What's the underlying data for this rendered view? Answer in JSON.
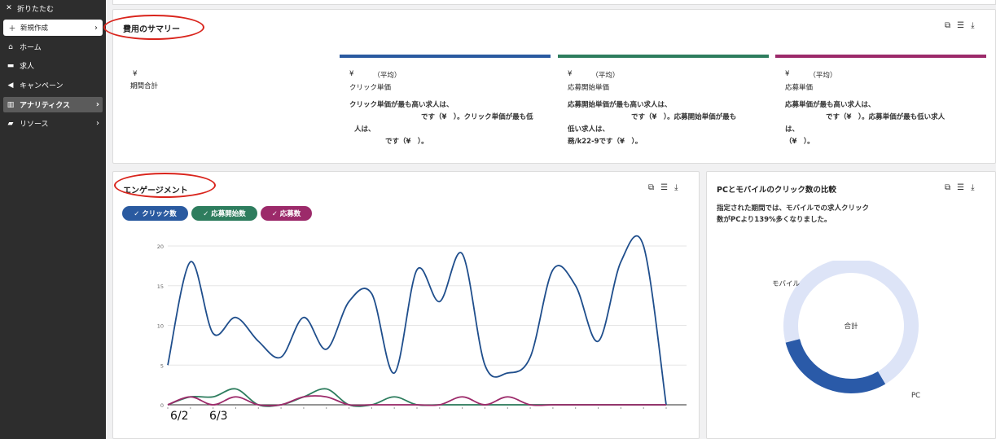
{
  "sidebar": {
    "collapse_label": "折りたたむ",
    "new_label": "新規作成",
    "items": [
      {
        "label": "ホーム",
        "icon": "home-icon"
      },
      {
        "label": "求人",
        "icon": "briefcase-icon"
      },
      {
        "label": "キャンペーン",
        "icon": "megaphone-icon"
      },
      {
        "label": "アナリティクス",
        "icon": "bar-chart-icon",
        "active": true
      },
      {
        "label": "リソース",
        "icon": "folder-icon"
      }
    ]
  },
  "summary": {
    "title": "費用のサマリー",
    "period_currency": "¥",
    "period_label": "期間合計",
    "columns": [
      {
        "color": "#2a5aa0",
        "currency": "¥",
        "avg": "（平均）",
        "label": "クリック単価",
        "desc_a": "クリック単価が最も高い求人は、",
        "desc_b": "です（¥　）。クリック単価が最も低",
        "desc_c": "人は、",
        "desc_d": "です（¥　）。"
      },
      {
        "color": "#2e7d5e",
        "currency": "¥",
        "avg": "（平均）",
        "label": "応募開始単価",
        "desc_a": "応募開始単価が最も高い求人は、",
        "desc_b": "です（¥　）。応募開始単価が最も",
        "desc_c": "低い求人は、",
        "desc_d": "務/k22-9です（¥　）。"
      },
      {
        "color": "#9c2a6a",
        "currency": "¥",
        "avg": "（平均）",
        "label": "応募単価",
        "desc_a": "応募単価が最も高い求人は、",
        "desc_b": "です（¥　）。応募単価が最も低い求人",
        "desc_c": "は、",
        "desc_d": "（¥　）。"
      }
    ]
  },
  "engagement": {
    "title": "エンゲージメント",
    "pills": [
      {
        "label": "✓ クリック数",
        "color": "#2a5aa0"
      },
      {
        "label": "✓ 応募開始数",
        "color": "#2e7d5e"
      },
      {
        "label": "✓ 応募数",
        "color": "#9c2a6a"
      }
    ],
    "x_annotations": [
      "6/2",
      "6/3"
    ]
  },
  "chart_data": {
    "type": "line",
    "title": "",
    "xlabel": "",
    "ylabel": "",
    "ylim": [
      0,
      20
    ],
    "yticks": [
      "0",
      "5",
      "10",
      "15",
      "20"
    ],
    "grid": true,
    "series": [
      {
        "name": "クリック数",
        "color": "#1f4e8c",
        "values": [
          5,
          18,
          9,
          11,
          8,
          6,
          11,
          7,
          13,
          14,
          4,
          17,
          13,
          19,
          5,
          4,
          6,
          17,
          15,
          8,
          18,
          20,
          0
        ]
      },
      {
        "name": "応募開始数",
        "color": "#2e7d5e",
        "values": [
          0,
          1,
          1,
          2,
          0,
          0,
          1,
          2,
          0,
          0,
          1,
          0,
          0,
          0,
          0,
          0,
          0,
          0,
          0,
          0,
          0,
          0,
          0
        ]
      },
      {
        "name": "応募数",
        "color": "#9c2a6a",
        "values": [
          0,
          1,
          0,
          1,
          0,
          0,
          1,
          1,
          0,
          0,
          0,
          0,
          0,
          1,
          0,
          1,
          0,
          0,
          0,
          0,
          0,
          0,
          0
        ]
      }
    ]
  },
  "pc_mobile": {
    "title": "PCとモバイルのクリック数の比較",
    "desc_line1": "指定された期間では、モバイルでの求人クリック",
    "desc_line2": "数がPCより139%多くなりました。",
    "center_label": "合計",
    "mobile_label": "モバイル",
    "pc_label": "PC",
    "chart": {
      "type": "pie",
      "series": [
        {
          "name": "PC",
          "value": 29.5,
          "color": "#2a5aa8"
        },
        {
          "name": "モバイル",
          "value": 70.5,
          "color": "#dde4f7"
        }
      ]
    }
  }
}
